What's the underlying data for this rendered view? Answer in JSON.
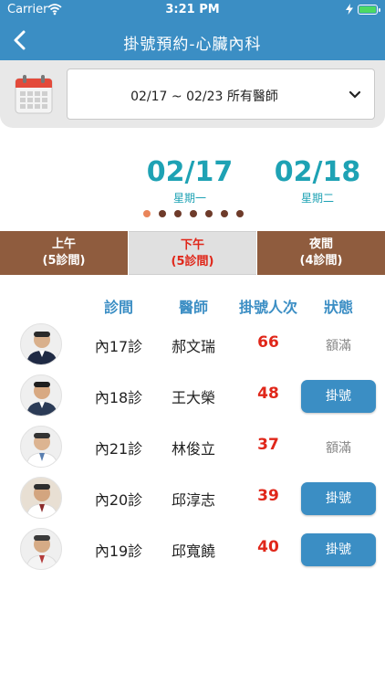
{
  "status_bar": {
    "carrier": "Carrier",
    "time": "3:21 PM"
  },
  "nav": {
    "title": "掛號預約-心臟內科"
  },
  "filter": {
    "label": "02/17 ~ 02/23  所有醫師"
  },
  "dates": [
    {
      "date": "02/17",
      "weekday": "星期一"
    },
    {
      "date": "02/18",
      "weekday": "星期二"
    }
  ],
  "pager": {
    "count": 7,
    "active_index": 0,
    "active_color": "#e9855a",
    "inactive_color": "#6e3b2a"
  },
  "periods": [
    {
      "name": "上午",
      "count": "(5診間)"
    },
    {
      "name": "下午",
      "count": "(5診間)"
    },
    {
      "name": "夜間",
      "count": "(4診間)"
    }
  ],
  "table": {
    "headers": [
      "診間",
      "醫師",
      "掛號人次",
      "狀態"
    ],
    "rows": [
      {
        "room": "內17診",
        "doctor": "郝文瑞",
        "count": "66",
        "status": "額滿"
      },
      {
        "room": "內18診",
        "doctor": "王大榮",
        "count": "48",
        "status": "掛號"
      },
      {
        "room": "內21診",
        "doctor": "林俊立",
        "count": "37",
        "status": "額滿"
      },
      {
        "room": "內20診",
        "doctor": "邱淳志",
        "count": "39",
        "status": "掛號"
      },
      {
        "room": "內19診",
        "doctor": "邱寬饒",
        "count": "40",
        "status": "掛號"
      }
    ]
  },
  "colors": {
    "primary": "#3b8ec4",
    "teal": "#1ea2b4",
    "brown": "#8f5c3e",
    "red": "#e0271a"
  },
  "icons": [
    "wifi-icon",
    "battery-icon",
    "back-chevron-icon",
    "calendar-icon",
    "chevron-down-icon",
    "doctor-avatar"
  ]
}
